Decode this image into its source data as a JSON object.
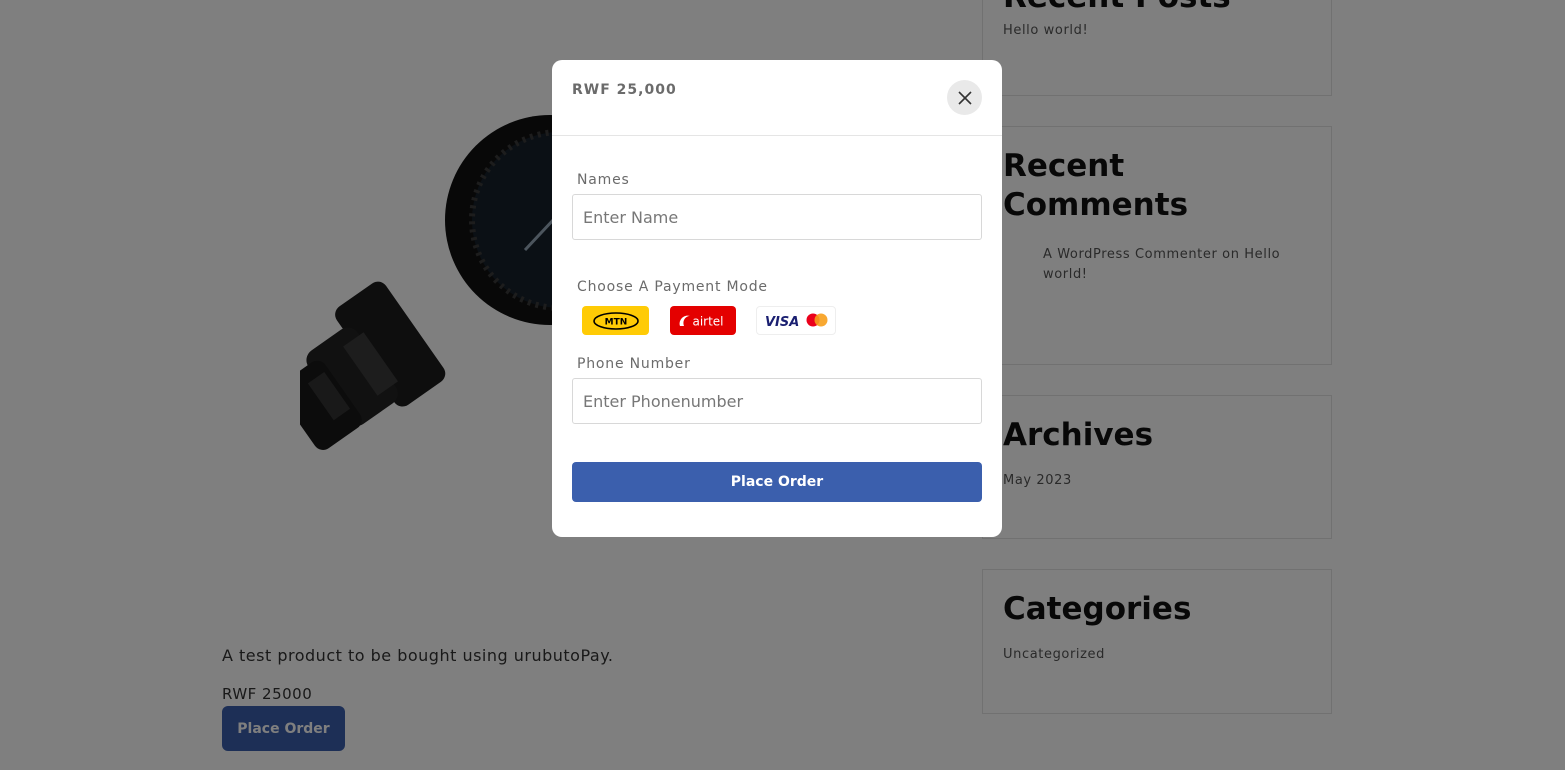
{
  "product": {
    "description": "A test product to be bought using urubutoPay.",
    "price": "RWF 25000",
    "order_label": "Place Order"
  },
  "sidebar": {
    "recent_posts": {
      "title": "Recent Posts",
      "items": [
        "Hello world!"
      ]
    },
    "recent_comments": {
      "title": "Recent Comments",
      "items": [
        "A WordPress Commenter on Hello world!"
      ]
    },
    "archives": {
      "title": "Archives",
      "items": [
        "May 2023"
      ]
    },
    "categories": {
      "title": "Categories",
      "items": [
        "Uncategorized"
      ]
    }
  },
  "modal": {
    "amount": "RWF 25,000",
    "names_label": "Names",
    "names_placeholder": "Enter Name",
    "payment_label": "Choose A Payment Mode",
    "payment_options": [
      {
        "id": "mtn",
        "label": "MTN"
      },
      {
        "id": "airtel",
        "label": "airtel"
      },
      {
        "id": "card",
        "label": "VISA"
      }
    ],
    "phone_label": "Phone Number",
    "phone_placeholder": "Enter Phonenumber",
    "order_label": "Place Order"
  },
  "colors": {
    "primary": "#3b5fad",
    "mtn": "#ffcb05",
    "airtel": "#e40000",
    "visa": "#1a1f71",
    "overlay": "rgba(0,0,0,0.5)"
  }
}
